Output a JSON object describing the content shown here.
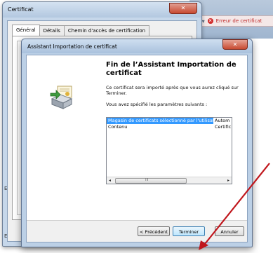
{
  "browser": {
    "address_symbols": "ρ ▾",
    "error_icon": "×",
    "error_text": "Erreur de certificat"
  },
  "cert_window": {
    "title": "Certificat",
    "close_glyph": "✕",
    "tabs": [
      {
        "label": "Général"
      },
      {
        "label": "Détails"
      },
      {
        "label": "Chemin d'accès de certification"
      }
    ],
    "side_label_1": "E",
    "side_label_2": "E"
  },
  "wizard": {
    "title": "Assistant Importation de certificat",
    "close_glyph": "✕",
    "heading": "Fin de l’Assistant Importation de certificat",
    "description": "Ce certificat sera importé après que vous aurez cliqué sur Terminer.",
    "settings_label": "Vous avez spécifié les paramètres suivants :",
    "settings_rows": [
      {
        "name": "Magasin de certificats sélectionné par l'utilisateur",
        "value": "Autom"
      },
      {
        "name": "Contenu",
        "value": "Certific"
      }
    ],
    "scroll_left": "◂",
    "scroll_right": "▸",
    "scroll_grip": "III",
    "buttons": {
      "back": "< Précédent",
      "finish": "Terminer",
      "cancel": "Annuler"
    }
  },
  "annotation": {
    "arrow_color": "#c0161c"
  }
}
